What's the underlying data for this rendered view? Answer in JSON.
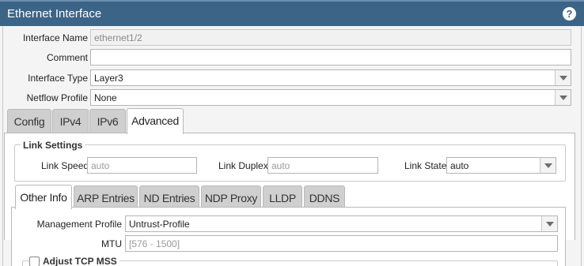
{
  "window": {
    "title": "Ethernet Interface",
    "help_icon": "?"
  },
  "form": {
    "interface_name": {
      "label": "Interface Name",
      "value": "ethernet1/2"
    },
    "comment": {
      "label": "Comment",
      "value": ""
    },
    "interface_type": {
      "label": "Interface Type",
      "value": "Layer3"
    },
    "netflow_profile": {
      "label": "Netflow Profile",
      "value": "None"
    }
  },
  "tabs": [
    "Config",
    "IPv4",
    "IPv6",
    "Advanced"
  ],
  "active_tab": "Advanced",
  "link_settings": {
    "legend": "Link Settings",
    "link_speed": {
      "label": "Link Speed",
      "placeholder": "auto"
    },
    "link_duplex": {
      "label": "Link Duplex",
      "placeholder": "auto"
    },
    "link_state": {
      "label": "Link State",
      "value": "auto"
    }
  },
  "subtabs": [
    "Other Info",
    "ARP Entries",
    "ND Entries",
    "NDP Proxy",
    "LLDP",
    "DDNS"
  ],
  "active_subtab": "Other Info",
  "other_info": {
    "management_profile": {
      "label": "Management Profile",
      "value": "Untrust-Profile"
    },
    "mtu": {
      "label": "MTU",
      "placeholder": "[576 - 1500]"
    },
    "adjust_tcp_mss": {
      "label": "Adjust TCP MSS",
      "checked": false
    }
  }
}
